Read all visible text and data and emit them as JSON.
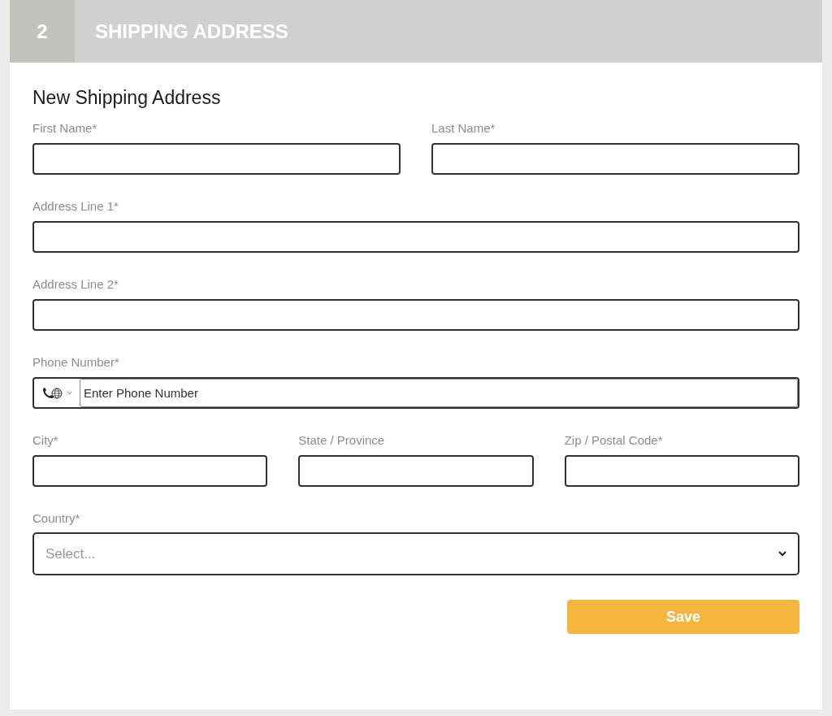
{
  "section": {
    "number": "2",
    "title": "SHIPPING ADDRESS"
  },
  "form": {
    "heading": "New Shipping Address",
    "rows": [
      [
        {
          "kind": "text",
          "label": "First Name*"
        },
        {
          "kind": "text",
          "label": "Last Name*"
        }
      ],
      [
        {
          "kind": "text",
          "label": "Address Line 1*"
        }
      ],
      [
        {
          "kind": "text",
          "label": "Address Line 2*"
        }
      ],
      [
        {
          "kind": "phone",
          "label": "Phone Number*",
          "placeholder": "Enter Phone Number"
        }
      ],
      [
        {
          "kind": "text",
          "label": "City*"
        },
        {
          "kind": "text",
          "label": "State / Province"
        },
        {
          "kind": "text",
          "label": "Zip / Postal Code*"
        }
      ],
      [
        {
          "kind": "select",
          "label": "Country*",
          "placeholder": "Select..."
        }
      ]
    ],
    "save_button": "Save"
  }
}
